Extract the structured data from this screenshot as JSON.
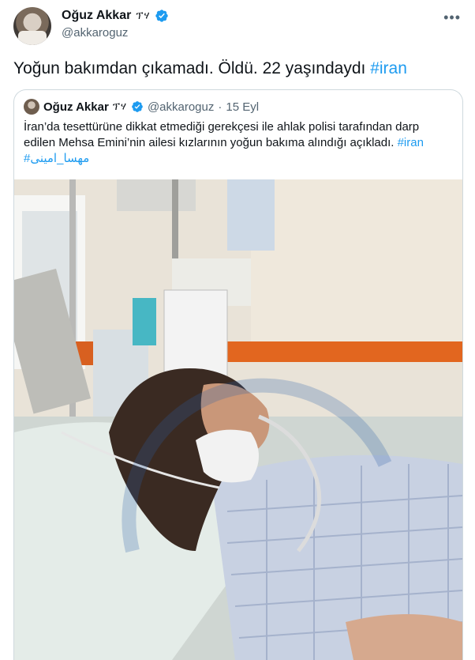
{
  "author": {
    "name": "Oğuz Akkar",
    "name_suffix": "ፕሃ",
    "handle": "@akkaroguz"
  },
  "tweet": {
    "text": "Yoğun bakımdan çıkamadı. Öldü. 22 yaşındaydı ",
    "hashtag": "#iran"
  },
  "quoted": {
    "name": "Oğuz Akkar",
    "name_suffix": "ፕሃ",
    "handle": "@akkaroguz",
    "separator": "·",
    "date": "15 Eyl",
    "text": "İran’da tesettürüne dikkat etmediği gerekçesi ile ahlak polisi tarafından darp edilen Mehsa Emini’nin ailesi kızlarının yoğun bakıma alındığı açıkladı. ",
    "hashtag_iran": "#iran",
    "hashtag_fa": "#مهسا_امینی"
  },
  "colors": {
    "link": "#1d9bf0",
    "verified": "#1d9bf0",
    "secondary_text": "#536471",
    "border": "#cfd9de"
  },
  "icons": [
    "verified-badge-icon",
    "more-options-icon"
  ]
}
